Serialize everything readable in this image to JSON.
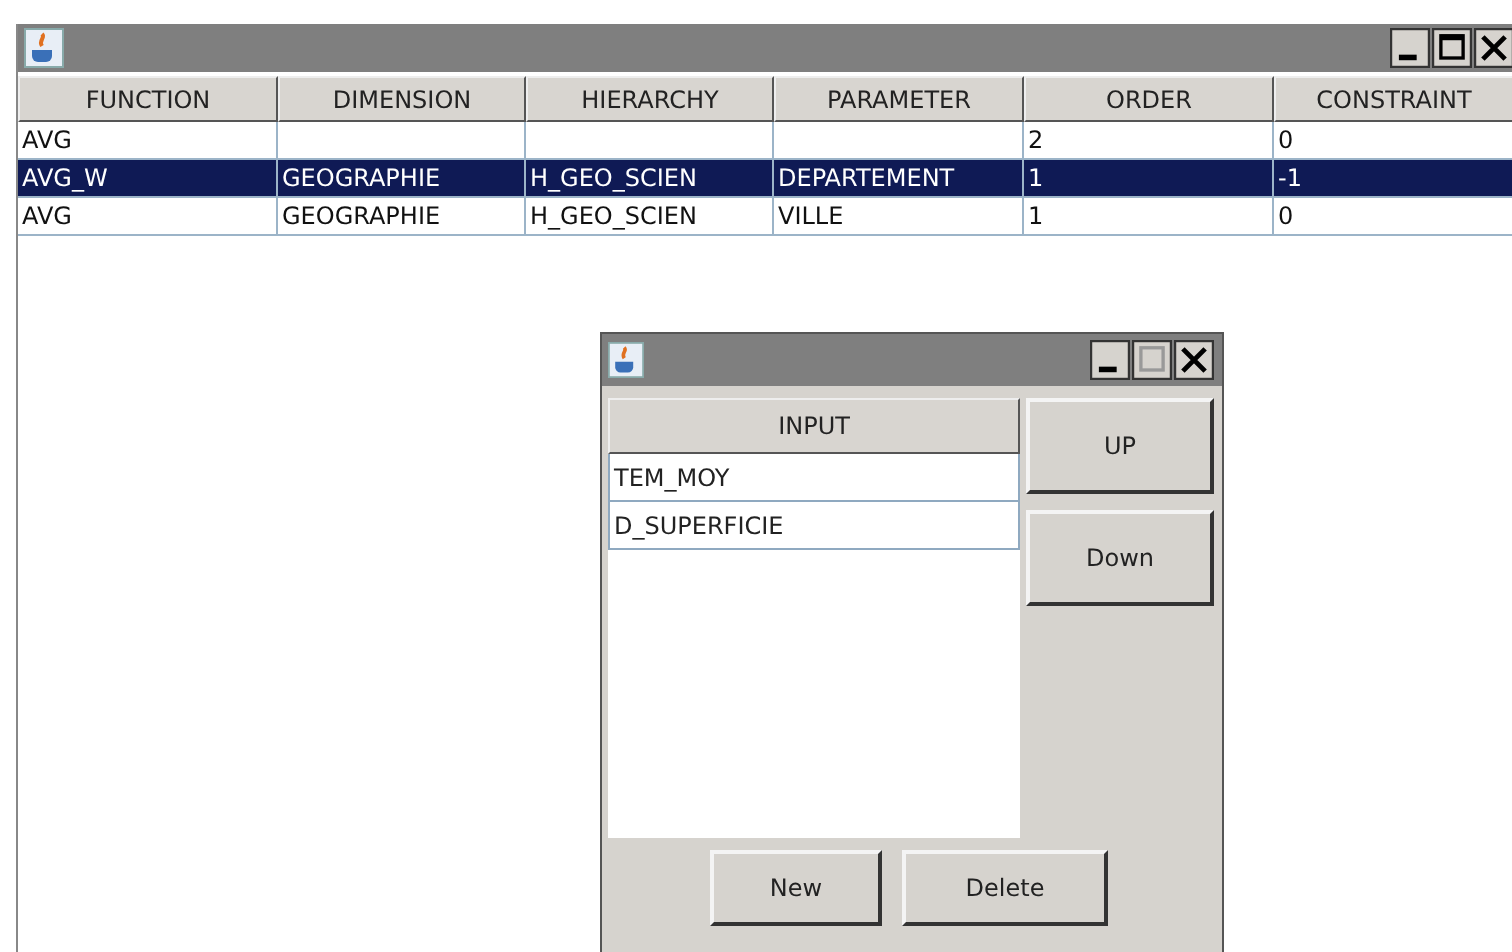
{
  "table": {
    "columns": [
      "FUNCTION",
      "DIMENSION",
      "HIERARCHY",
      "PARAMETER",
      "ORDER",
      "CONSTRAINT"
    ],
    "rows": [
      {
        "cells": [
          "AVG",
          "",
          "",
          "",
          "2",
          "0"
        ],
        "selected": false
      },
      {
        "cells": [
          "AVG_W",
          "GEOGRAPHIE",
          "H_GEO_SCIEN",
          "DEPARTEMENT",
          "1",
          "-1"
        ],
        "selected": true
      },
      {
        "cells": [
          "AVG",
          "GEOGRAPHIE",
          "H_GEO_SCIEN",
          "VILLE",
          "1",
          "0"
        ],
        "selected": false
      }
    ]
  },
  "dialog": {
    "table": {
      "columns": [
        "INPUT"
      ],
      "rows": [
        {
          "cells": [
            "TEM_MOY"
          ],
          "selected": false
        },
        {
          "cells": [
            "D_SUPERFICIE"
          ],
          "selected": false
        }
      ]
    },
    "side_buttons": [
      "UP",
      "Down"
    ],
    "bottom_buttons": [
      "New",
      "Delete"
    ]
  }
}
